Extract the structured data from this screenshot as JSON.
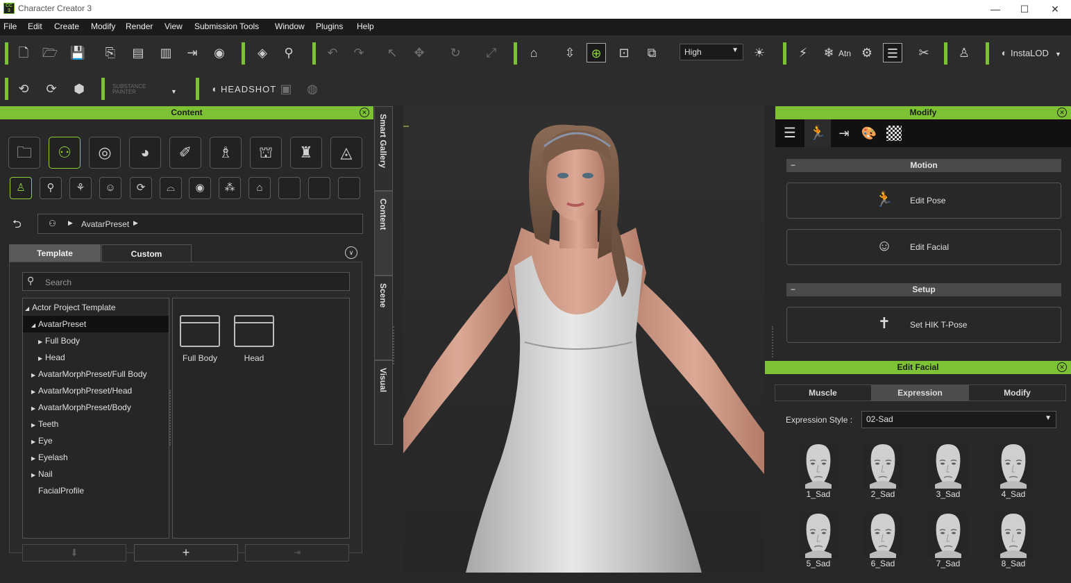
{
  "window": {
    "title": "Character Creator 3",
    "minimize": "—",
    "maximize": "☐",
    "close": "✕"
  },
  "menu": [
    "File",
    "Edit",
    "Create",
    "Modify",
    "Render",
    "View",
    "Submission Tools",
    "Window",
    "Plugins",
    "Help"
  ],
  "toolbar": {
    "quality": "High",
    "atn_label": "Atn",
    "instalod_label": "InstaLOD",
    "substance_label": "SUBSTANCE PAINTER",
    "headshot_label": "HEADSHOT"
  },
  "content_panel": {
    "title": "Content",
    "breadcrumb": "AvatarPreset",
    "tabs": [
      "Template",
      "Custom"
    ],
    "search_placeholder": "Search",
    "tree": [
      {
        "label": "Actor Project Template",
        "expanded": true
      },
      {
        "label": "AvatarPreset",
        "expanded": true,
        "selected": true
      },
      {
        "label": "Full Body"
      },
      {
        "label": "Head"
      },
      {
        "label": "AvatarMorphPreset/Full Body"
      },
      {
        "label": "AvatarMorphPreset/Head"
      },
      {
        "label": "AvatarMorphPreset/Body"
      },
      {
        "label": "Teeth"
      },
      {
        "label": "Eye"
      },
      {
        "label": "Eyelash"
      },
      {
        "label": "Nail"
      },
      {
        "label": "FacialProfile"
      }
    ],
    "folders": [
      "Full Body",
      "Head"
    ]
  },
  "side_tabs": [
    "Smart Gallery",
    "Content",
    "Scene",
    "Visual"
  ],
  "modify_panel": {
    "title": "Modify",
    "sections": {
      "motion": "Motion",
      "setup": "Setup"
    },
    "buttons": {
      "edit_pose": "Edit Pose",
      "edit_facial": "Edit Facial",
      "set_hik": "Set HIK T-Pose"
    }
  },
  "edit_facial_panel": {
    "title": "Edit Facial",
    "tabs": [
      "Muscle",
      "Expression",
      "Modify"
    ],
    "style_label": "Expression Style :",
    "style_value": "02-Sad",
    "expressions": [
      "1_Sad",
      "2_Sad",
      "3_Sad",
      "4_Sad",
      "5_Sad",
      "6_Sad",
      "7_Sad",
      "8_Sad"
    ]
  },
  "colors": {
    "accent": "#7cc234",
    "panel": "#282828",
    "menubar": "#1b1b1b"
  }
}
